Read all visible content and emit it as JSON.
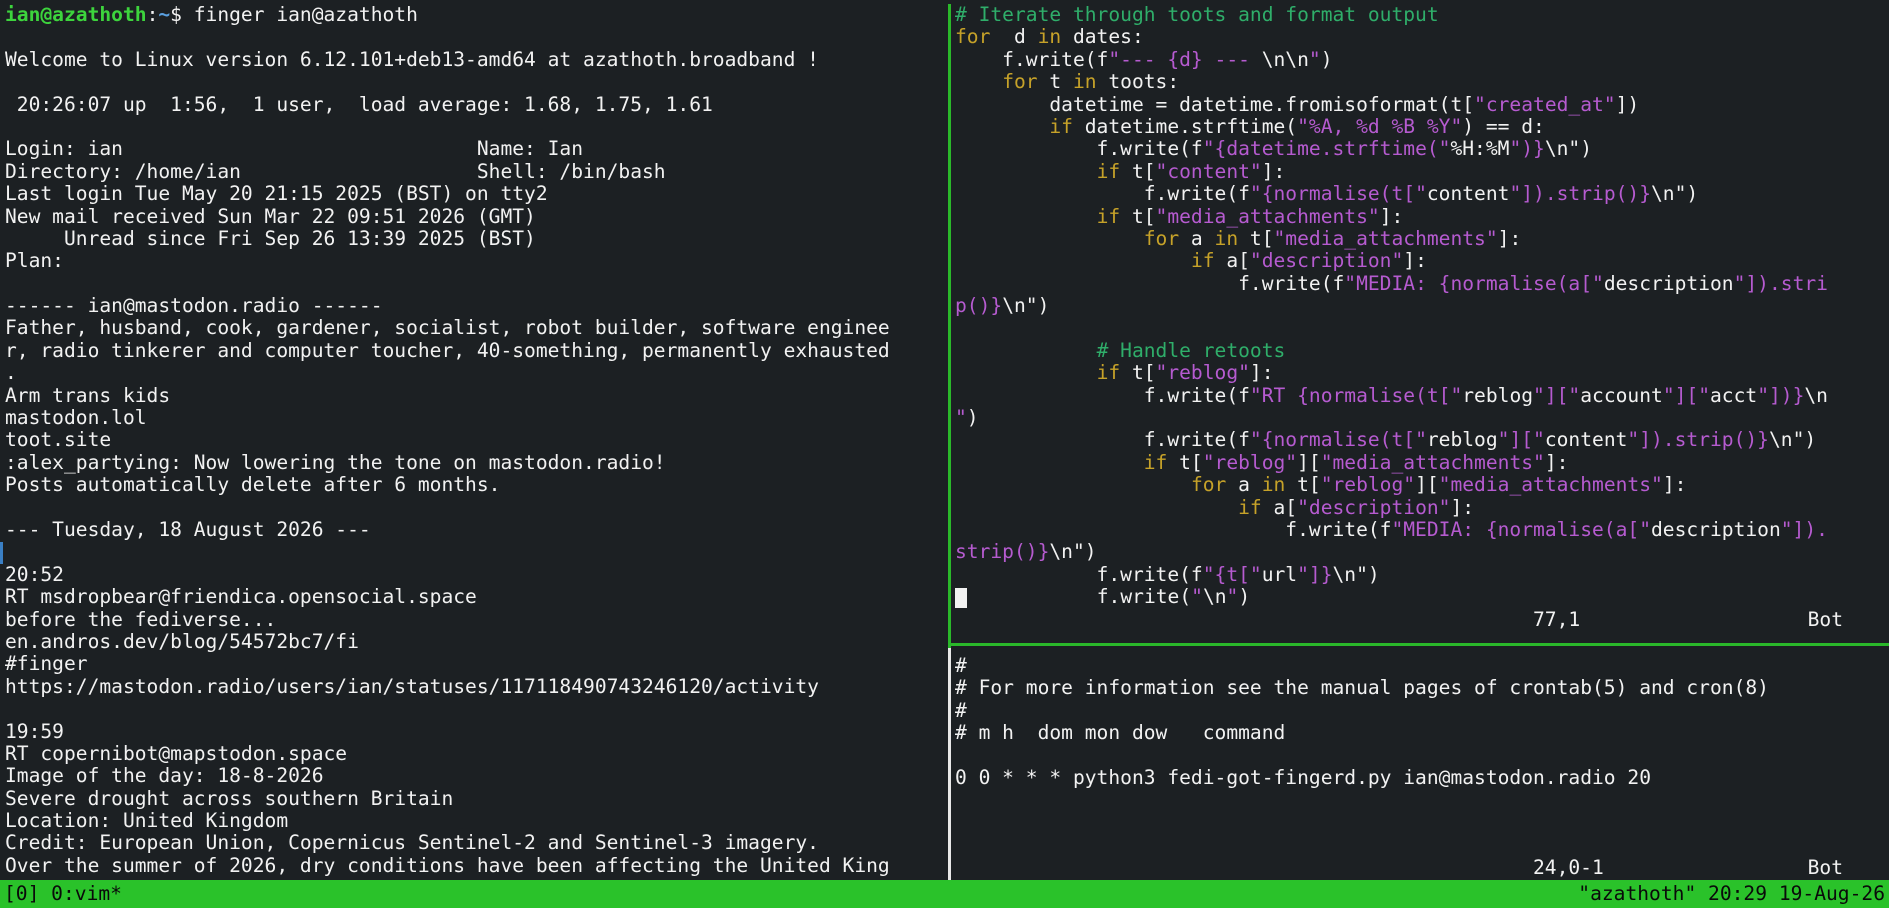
{
  "left_pane": {
    "prompt": {
      "user": "ian@azathoth",
      "sep": ":",
      "path": "~",
      "command": "$ finger ian@azathoth"
    },
    "lines": [
      "",
      "Welcome to Linux version 6.12.101+deb13-amd64 at azathoth.broadband !",
      "",
      " 20:26:07 up  1:56,  1 user,  load average: 1.68, 1.75, 1.61",
      "",
      "Login: ian                              Name: Ian",
      "Directory: /home/ian                    Shell: /bin/bash",
      "Last login Tue May 20 21:15 2025 (BST) on tty2",
      "New mail received Sun Mar 22 09:51 2026 (GMT)",
      "     Unread since Fri Sep 26 13:39 2025 (BST)",
      "Plan:",
      "",
      "------ ian@mastodon.radio ------",
      "Father, husband, cook, gardener, socialist, robot builder, software enginee",
      "r, radio tinkerer and computer toucher, 40-something, permanently exhausted",
      ".",
      "Arm trans kids",
      "mastodon.lol",
      "toot.site",
      ":alex_partying: Now lowering the tone on mastodon.radio!",
      "Posts automatically delete after 6 months.",
      "",
      "--- Tuesday, 18 August 2026 ---",
      "",
      "20:52",
      "RT msdropbear@friendica.opensocial.space",
      "before the fediverse...",
      "en.andros.dev/blog/54572bc7/fi",
      "#finger",
      "https://mastodon.radio/users/ian/statuses/117118490743246120/activity",
      "",
      "19:59",
      "RT copernibot@mapstodon.space",
      "Image of the day: 18-8-2026",
      "Severe drought across southern Britain",
      "Location: United Kingdom",
      "Credit: European Union, Copernicus Sentinel-2 and Sentinel-3 imagery.",
      "Over the summer of 2026, dry conditions have been affecting the United King"
    ]
  },
  "vim_pane": {
    "code": [
      [
        [
          "cmt",
          "# Iterate through toots and format output"
        ]
      ],
      [
        [
          "kw",
          "for"
        ],
        [
          "",
          "  d "
        ],
        [
          "kw",
          "in"
        ],
        [
          "",
          " dates:"
        ]
      ],
      [
        [
          "",
          "    f.write(f"
        ],
        [
          "str",
          "\"--- {d} --- "
        ],
        [
          "",
          "\\n\\n"
        ],
        [
          "str",
          "\""
        ],
        [
          "",
          ")"
        ]
      ],
      [
        [
          "",
          "    "
        ],
        [
          "kw",
          "for"
        ],
        [
          "",
          "",
          " t "
        ],
        [
          "kw",
          "in"
        ],
        [
          "",
          "",
          " toots:"
        ]
      ],
      [
        [
          "",
          "        datetime = datetime.fromisoformat(t["
        ],
        [
          "str",
          "\"created_at\""
        ],
        [
          "",
          "])"
        ]
      ],
      [
        [
          "",
          "        "
        ],
        [
          "kw",
          "if"
        ],
        [
          "",
          "",
          " datetime.strftime("
        ],
        [
          "str",
          "\"%A, %d %B %Y\""
        ],
        [
          "",
          ") == d:"
        ]
      ],
      [
        [
          "",
          "            f.write(f"
        ],
        [
          "str",
          "\"{datetime.strftime(\""
        ],
        [
          "",
          "%H:%M"
        ],
        [
          "str",
          "\")}"
        ],
        [
          "",
          "\\n\")"
        ]
      ],
      [
        [
          "",
          "            "
        ],
        [
          "kw",
          "if"
        ],
        [
          "",
          "",
          " t["
        ],
        [
          "str",
          "\"content\""
        ],
        [
          "",
          "]:"
        ]
      ],
      [
        [
          "",
          "                f.write(f"
        ],
        [
          "str",
          "\"{normalise(t[\""
        ],
        [
          "",
          "content"
        ],
        [
          "str",
          "\"]).strip()}"
        ],
        [
          "",
          "\\n\")"
        ]
      ],
      [
        [
          "",
          "            "
        ],
        [
          "kw",
          "if"
        ],
        [
          "",
          "",
          " t["
        ],
        [
          "str",
          "\"media_attachments\""
        ],
        [
          "",
          "]:"
        ]
      ],
      [
        [
          "",
          "                "
        ],
        [
          "kw",
          "for"
        ],
        [
          "",
          "",
          " a "
        ],
        [
          "kw",
          "in"
        ],
        [
          "",
          "",
          " t["
        ],
        [
          "str",
          "\"media_attachments\""
        ],
        [
          "",
          "]:"
        ]
      ],
      [
        [
          "",
          "                    "
        ],
        [
          "kw",
          "if"
        ],
        [
          "",
          "",
          " a["
        ],
        [
          "str",
          "\"description\""
        ],
        [
          "",
          "]:"
        ]
      ],
      [
        [
          "",
          "                        f.write(f"
        ],
        [
          "str",
          "\"MEDIA: {normalise(a[\""
        ],
        [
          "",
          "description"
        ],
        [
          "str",
          "\"]).stri"
        ]
      ],
      [
        [
          "str",
          "p()}"
        ],
        [
          "",
          "\\n\")"
        ]
      ],
      [
        [
          "",
          ""
        ]
      ],
      [
        [
          "",
          "            "
        ],
        [
          "cmt",
          "# Handle retoots"
        ]
      ],
      [
        [
          "",
          "            "
        ],
        [
          "kw",
          "if"
        ],
        [
          "",
          "",
          " t["
        ],
        [
          "str",
          "\"reblog\""
        ],
        [
          "",
          "]:"
        ]
      ],
      [
        [
          "",
          "                f.write(f"
        ],
        [
          "str",
          "\"RT {normalise(t[\""
        ],
        [
          "",
          "reblog"
        ],
        [
          "str",
          "\"][\""
        ],
        [
          "",
          "account"
        ],
        [
          "str",
          "\"][\""
        ],
        [
          "",
          "acct"
        ],
        [
          "str",
          "\"])}"
        ],
        [
          "",
          "\\n"
        ]
      ],
      [
        [
          "str",
          "\""
        ],
        [
          "",
          ")"
        ]
      ],
      [
        [
          "",
          "                f.write(f"
        ],
        [
          "str",
          "\"{normalise(t[\""
        ],
        [
          "",
          "reblog"
        ],
        [
          "str",
          "\"][\""
        ],
        [
          "",
          "content"
        ],
        [
          "str",
          "\"]).strip()}"
        ],
        [
          "",
          "\\n\")"
        ]
      ],
      [
        [
          "",
          "                "
        ],
        [
          "kw",
          "if"
        ],
        [
          "",
          "",
          " t["
        ],
        [
          "str",
          "\"reblog\""
        ],
        [
          "",
          "]["
        ],
        [
          "str",
          "\"media_attachments\""
        ],
        [
          "",
          "]:"
        ]
      ],
      [
        [
          "",
          "                    "
        ],
        [
          "kw",
          "for"
        ],
        [
          "",
          "",
          " a "
        ],
        [
          "kw",
          "in"
        ],
        [
          "",
          "",
          " t["
        ],
        [
          "str",
          "\"reblog\""
        ],
        [
          "",
          "]["
        ],
        [
          "str",
          "\"media_attachments\""
        ],
        [
          "",
          "]:"
        ]
      ],
      [
        [
          "",
          "                        "
        ],
        [
          "kw",
          "if"
        ],
        [
          "",
          "",
          " a["
        ],
        [
          "str",
          "\"description\""
        ],
        [
          "",
          "]:"
        ]
      ],
      [
        [
          "",
          "                            f.write(f"
        ],
        [
          "str",
          "\"MEDIA: {normalise(a[\""
        ],
        [
          "",
          "description"
        ],
        [
          "str",
          "\"])."
        ]
      ],
      [
        [
          "str",
          "strip()}"
        ],
        [
          "",
          "\\n\")"
        ]
      ],
      [
        [
          "",
          "            f.write(f"
        ],
        [
          "str",
          "\"{t[\""
        ],
        [
          "",
          "url"
        ],
        [
          "str",
          "\"]}"
        ],
        [
          "",
          "\\n\")"
        ]
      ],
      [
        [
          "",
          "            f.write("
        ],
        [
          "str",
          "\""
        ],
        [
          "",
          "\\n"
        ],
        [
          "str",
          "\""
        ],
        [
          "",
          ")"
        ]
      ]
    ],
    "ruler": {
      "position": "77,1",
      "scroll": "Bot"
    }
  },
  "crontab_pane": {
    "lines": [
      "#",
      "# For more information see the manual pages of crontab(5) and cron(8)",
      "#",
      "# m h  dom mon dow   command",
      "",
      "0 0 * * * python3 fedi-got-fingerd.py ian@mastodon.radio 20",
      "",
      "",
      ""
    ],
    "ruler": {
      "position": "24,0-1",
      "scroll": "Bot"
    }
  },
  "tmux_status": {
    "left": "[0] 0:vim*",
    "right": "\"azathoth\" 20:29 19-Aug-26"
  },
  "colors": {
    "background": "#1c2023",
    "foreground": "#f2f2f2",
    "status_bar": "#2ac22a",
    "comment": "#2fae6a",
    "keyword": "#c6a229",
    "string": "#b65bd0"
  }
}
